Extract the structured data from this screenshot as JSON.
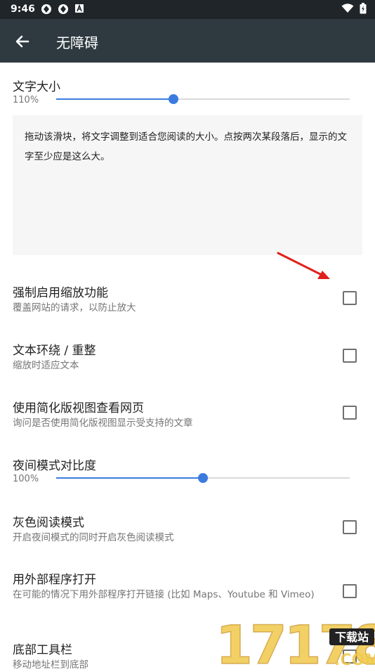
{
  "status_bar": {
    "time": "9:46"
  },
  "toolbar": {
    "title": "无障碍"
  },
  "text_size": {
    "label": "文字大小",
    "value_text": "110%",
    "fraction": 0.4
  },
  "preview": {
    "text": "拖动该滑块，将文字调整到适合您阅读的大小。点按两次某段落后，显示的文字至少应是这么大。"
  },
  "prefs": [
    {
      "title": "强制启用缩放功能",
      "summary": "覆盖网站的请求，以防止放大",
      "checked": false
    },
    {
      "title": "文本环绕 / 重整",
      "summary": "缩放时适应文本",
      "checked": false
    },
    {
      "title": "使用简化版视图查看网页",
      "summary": "询问是否使用简化版视图显示受支持的文章",
      "checked": false
    }
  ],
  "night_contrast": {
    "label": "夜间模式对比度",
    "value_text": "100%",
    "fraction": 0.5
  },
  "prefs2": [
    {
      "title": "灰色阅读模式",
      "summary": "开启夜间模式的同时开启灰色阅读模式",
      "checked": false
    },
    {
      "title": "用外部程序打开",
      "summary": "在可能的情况下用外部程序打开链接 (比如 Maps、Youtube 和 Vimeo)",
      "checked": false
    },
    {
      "title": "底部工具栏",
      "summary": "移动地址栏到底部",
      "checked": false
    }
  ],
  "watermark": {
    "number": "17178",
    "badge": "下载站",
    "suffix": ".COM"
  },
  "colors": {
    "toolbar": "#2f3a40",
    "status_bar": "#1f2529",
    "accent": "#3b7be0",
    "annotation_arrow": "#e0201b"
  }
}
